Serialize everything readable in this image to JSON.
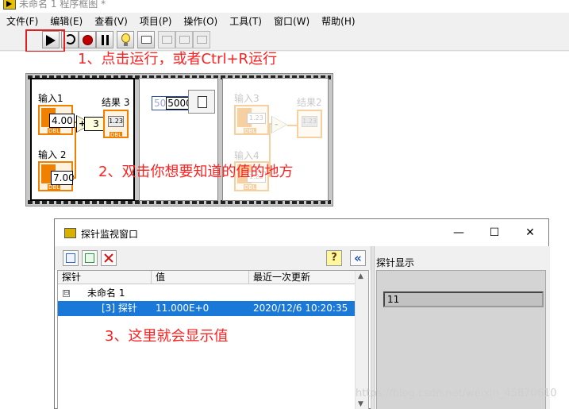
{
  "window": {
    "title": "未命名 1 程序框图 *"
  },
  "menu": [
    "文件(F)",
    "编辑(E)",
    "查看(V)",
    "项目(P)",
    "操作(O)",
    "工具(T)",
    "窗口(W)",
    "帮助(H)"
  ],
  "toolbar": {
    "icons": [
      "run-arrow-icon",
      "run-continuously-icon",
      "abort-icon",
      "pause-icon",
      "highlight-execution-icon",
      "retain-wire-values-icon",
      "step-into-icon",
      "step-over-icon",
      "step-out-icon"
    ]
  },
  "annotations": {
    "step1": "1、点击运行，或者Ctrl+R运行",
    "step2": "2、双击你想要知道的值的地方",
    "step3": "3、这里就会显示值"
  },
  "diagram": {
    "input1": {
      "label": "输入1",
      "value": "4.00",
      "type": "DBL"
    },
    "input2": {
      "label": "输入 2",
      "value": "7.00",
      "type": "DBL"
    },
    "result3": {
      "label": "结果 3",
      "display": "1.23",
      "type": "DBL"
    },
    "add_op": "+",
    "probe_tag": "3",
    "constant_ghost": "50",
    "constant": "5000",
    "input3": {
      "label": "输入3",
      "display": "1.23",
      "type": "DBL"
    },
    "input4": {
      "label": "输入4",
      "display": "1.23",
      "type": "DBL"
    },
    "result2": {
      "label": "结果2",
      "display": "1.23",
      "type": "DBL"
    },
    "sub_op": "-"
  },
  "probe_window": {
    "title": "探针监视窗口",
    "minimize": "—",
    "maximize": "☐",
    "close": "✕",
    "tools": {
      "help": "?",
      "collapse": "«"
    },
    "columns": [
      "探针",
      "值",
      "最近一次更新"
    ],
    "group": "未命名 1",
    "tree_toggle": "⊟",
    "rows": [
      {
        "probe": "[3] 探针",
        "value": "11.000E+0",
        "updated": "2020/12/6 10:20:35"
      }
    ],
    "display_label": "探针显示",
    "display_value": "11"
  },
  "watermark": "https://blog.csdn.net/weixin_45870610"
}
